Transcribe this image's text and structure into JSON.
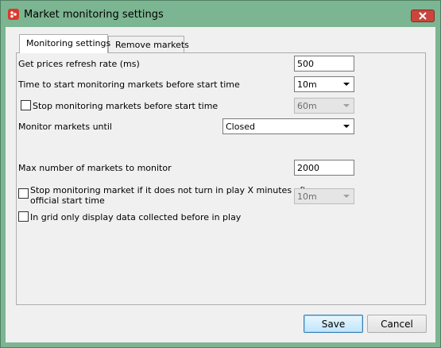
{
  "window": {
    "title": "Market monitoring settings"
  },
  "tabs": [
    {
      "label": "Monitoring settings",
      "active": true
    },
    {
      "label": "Remove markets",
      "active": false
    }
  ],
  "settings": {
    "refresh_rate_label": "Get prices refresh rate (ms)",
    "refresh_rate_value": "500",
    "start_time_label": "Time to start monitoring markets before start time",
    "start_time_value": "10m",
    "stop_before_label": "Stop monitoring markets before start time",
    "stop_before_checked": false,
    "stop_before_value": "60m",
    "monitor_until_label": "Monitor markets until",
    "monitor_until_value": "Closed",
    "max_markets_label": "Max number of markets to monitor",
    "max_markets_value": "2000",
    "stop_inplay_label_line1": "Stop monitoring market if it does not turn in play X minutes after",
    "stop_inplay_label_line2": "official start time",
    "stop_inplay_checked": false,
    "stop_inplay_value": "10m",
    "grid_only_label": "In grid only display data collected before in play",
    "grid_only_checked": false
  },
  "buttons": {
    "save_label": "Save",
    "cancel_label": "Cancel"
  }
}
